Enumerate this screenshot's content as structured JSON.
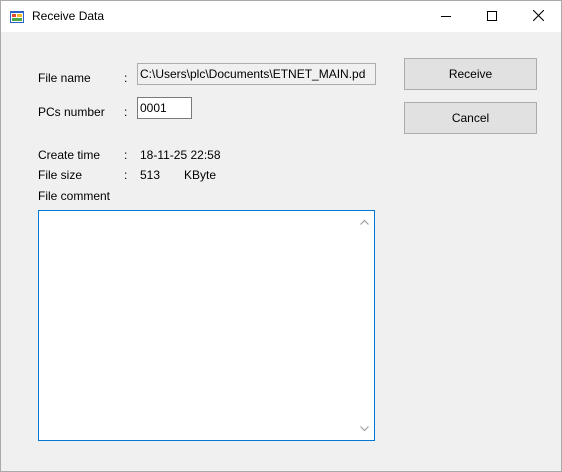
{
  "window": {
    "title": "Receive Data"
  },
  "form": {
    "file_name_label": "File name",
    "file_name_value": "C:\\Users\\plc\\Documents\\ETNET_MAIN.pd",
    "pcs_number_label": "PCs number",
    "pcs_number_value": "0001",
    "create_time_label": "Create time",
    "create_time_value": "18-11-25 22:58",
    "file_size_label": "File size",
    "file_size_value": "513",
    "file_size_unit": "KByte",
    "file_comment_label": "File comment",
    "file_comment_value": "",
    "colon": ":"
  },
  "buttons": {
    "receive": "Receive",
    "cancel": "Cancel"
  },
  "icons": {
    "app": "app-icon",
    "minimize": "minimize-icon",
    "maximize": "maximize-icon",
    "close": "close-icon"
  }
}
